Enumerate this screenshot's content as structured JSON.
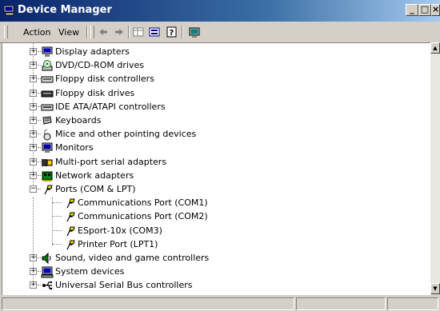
{
  "window": {
    "title": "Device Manager",
    "controls": {
      "minimize": "_",
      "maximize": "□",
      "close": "×"
    }
  },
  "menubar": {
    "items": [
      {
        "label": "Action"
      },
      {
        "label": "View"
      }
    ]
  },
  "toolbar": {
    "icons": [
      "back-arrow-icon",
      "forward-arrow-icon",
      "properties-grid-icon",
      "details-view-icon",
      "help-icon",
      "scan-hardware-icon"
    ]
  },
  "tree": {
    "items": [
      {
        "label": "Display adapters",
        "icon": "display-adapter-icon",
        "expanded": false
      },
      {
        "label": "DVD/CD-ROM drives",
        "icon": "cdrom-drive-icon",
        "expanded": false
      },
      {
        "label": "Floppy disk controllers",
        "icon": "disk-controller-icon",
        "expanded": false
      },
      {
        "label": "Floppy disk drives",
        "icon": "floppy-drive-icon",
        "expanded": false
      },
      {
        "label": "IDE ATA/ATAPI controllers",
        "icon": "ide-controller-icon",
        "expanded": false
      },
      {
        "label": "Keyboards",
        "icon": "keyboard-icon",
        "expanded": false
      },
      {
        "label": "Mice and other pointing devices",
        "icon": "mouse-icon",
        "expanded": false
      },
      {
        "label": "Monitors",
        "icon": "monitor-icon",
        "expanded": false
      },
      {
        "label": "Multi-port serial adapters",
        "icon": "multiport-adapter-icon",
        "expanded": false
      },
      {
        "label": "Network adapters",
        "icon": "network-adapter-icon",
        "expanded": false
      },
      {
        "label": "Ports (COM & LPT)",
        "icon": "port-icon",
        "expanded": true,
        "children": [
          {
            "label": "Communications Port (COM1)",
            "icon": "port-icon"
          },
          {
            "label": "Communications Port (COM2)",
            "icon": "port-icon"
          },
          {
            "label": "ESport-10x (COM3)",
            "icon": "port-icon"
          },
          {
            "label": "Printer Port (LPT1)",
            "icon": "port-icon"
          }
        ]
      },
      {
        "label": "Sound, video and game controllers",
        "icon": "sound-icon",
        "expanded": false
      },
      {
        "label": "System devices",
        "icon": "system-device-icon",
        "expanded": false
      },
      {
        "label": "Universal Serial Bus controllers",
        "icon": "usb-icon",
        "expanded": false
      }
    ]
  }
}
